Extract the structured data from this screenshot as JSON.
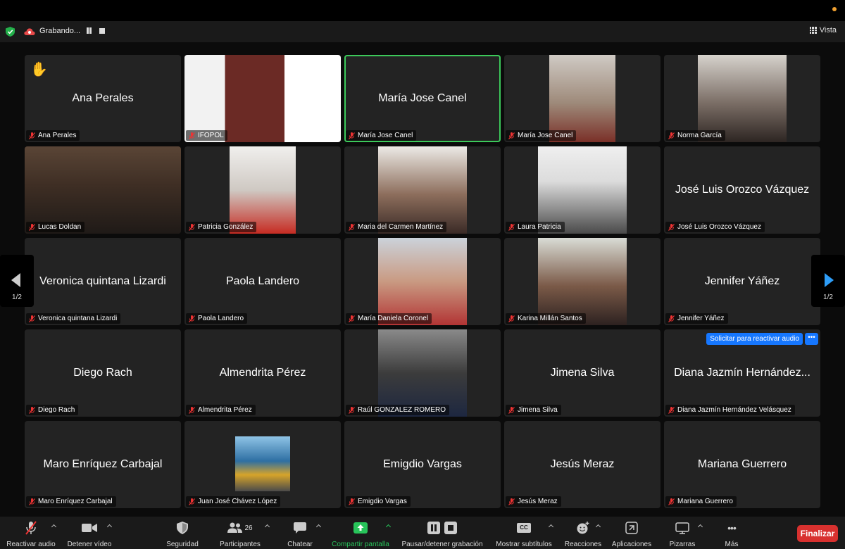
{
  "status": {
    "recording_label": "Grabando...",
    "view_label": "Vista"
  },
  "pager": {
    "left_page": "1/2",
    "right_page": "1/2"
  },
  "tiles": [
    {
      "name": "Ana Perales",
      "center_name": "Ana Perales",
      "hand": "✋"
    },
    {
      "name": "IFOPOL",
      "video": "logo"
    },
    {
      "name": "María Jose Canel",
      "center_name": "María Jose Canel",
      "active": true
    },
    {
      "name": "María Jose Canel",
      "video": "person"
    },
    {
      "name": "Norma García",
      "video": "person"
    },
    {
      "name": "Lucas Doldan",
      "video": "person"
    },
    {
      "name": "Patricia González",
      "video": "person"
    },
    {
      "name": "Maria del Carmen Martínez",
      "video": "person"
    },
    {
      "name": "Laura Patricia",
      "video": "person"
    },
    {
      "name": "José Luis Orozco Vázquez",
      "center_name": "José Luis Orozco Vázquez"
    },
    {
      "name": "Veronica quintana Lizardi",
      "center_name": "Veronica quintana Lizardi"
    },
    {
      "name": "Paola Landero",
      "center_name": "Paola Landero"
    },
    {
      "name": "María Daniela Coronel",
      "video": "person"
    },
    {
      "name": "Karina Millán Santos",
      "video": "person"
    },
    {
      "name": "Jennifer Yáñez",
      "center_name": "Jennifer Yáñez"
    },
    {
      "name": "Diego Rach",
      "center_name": "Diego Rach"
    },
    {
      "name": "Almendrita Pérez",
      "center_name": "Almendrita Pérez"
    },
    {
      "name": "Raúl GONZALEZ ROMERO",
      "video": "poster"
    },
    {
      "name": "Jimena Silva",
      "center_name": "Jimena Silva"
    },
    {
      "name": "Diana Jazmín Hernández Velásquez",
      "center_name": "Diana Jazmín Hernández...",
      "request_audio": "Solicitar para reactivar audio",
      "more": "•••"
    },
    {
      "name": "Maro Enríquez Carbajal",
      "center_name": "Maro Enríquez Carbajal"
    },
    {
      "name": "Juan José Chávez López",
      "video": "small"
    },
    {
      "name": "Emigdio Vargas",
      "center_name": "Emigdio Vargas"
    },
    {
      "name": "Jesús Meraz",
      "center_name": "Jesús Meraz"
    },
    {
      "name": "Mariana Guerrero",
      "center_name": "Mariana Guerrero"
    }
  ],
  "toolbar": {
    "unmute": "Reactivar audio",
    "stop_video": "Detener vídeo",
    "security": "Seguridad",
    "participants": "Participantes",
    "participants_count": "26",
    "chat": "Chatear",
    "share": "Compartir pantalla",
    "pause_record": "Pausar/detener grabación",
    "captions": "Mostrar subtítulos",
    "captions_icon": "CC",
    "reactions": "Reacciones",
    "apps": "Aplicaciones",
    "whiteboards": "Pizarras",
    "more": "Más",
    "more_icon": "•••",
    "finish": "Finalizar"
  },
  "colors": {
    "active_speaker": "#3cc95a",
    "share_green": "#28c45a",
    "finish_red": "#d8312f",
    "accent_blue": "#1677ff"
  }
}
